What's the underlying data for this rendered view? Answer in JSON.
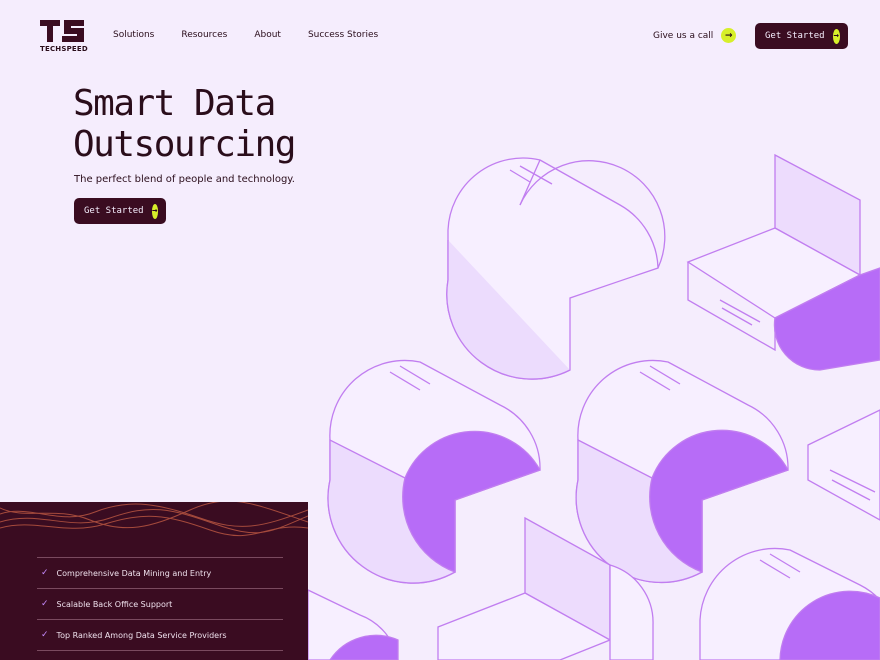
{
  "brand": {
    "logo_letters": "TS",
    "name": "TECHSPEED"
  },
  "nav": {
    "links": [
      "Solutions",
      "Resources",
      "About",
      "Success Stories"
    ],
    "call_label": "Give us a call",
    "cta_label": "Get Started"
  },
  "hero": {
    "title_line1": "Smart Data",
    "title_line2": "Outsourcing",
    "subtitle": "The perfect blend of people and technology.",
    "cta_label": "Get Started"
  },
  "features": {
    "items": [
      "Comprehensive Data Mining and Entry",
      "Scalable Back Office Support",
      "Top Ranked Among Data Service Providers"
    ],
    "check_icon": "check-icon"
  },
  "colors": {
    "background": "#f5edfd",
    "dark": "#3a0c21",
    "accent_lime": "#d7ef2a",
    "accent_purple": "#b76cf7",
    "outline": "#c17ef0"
  }
}
